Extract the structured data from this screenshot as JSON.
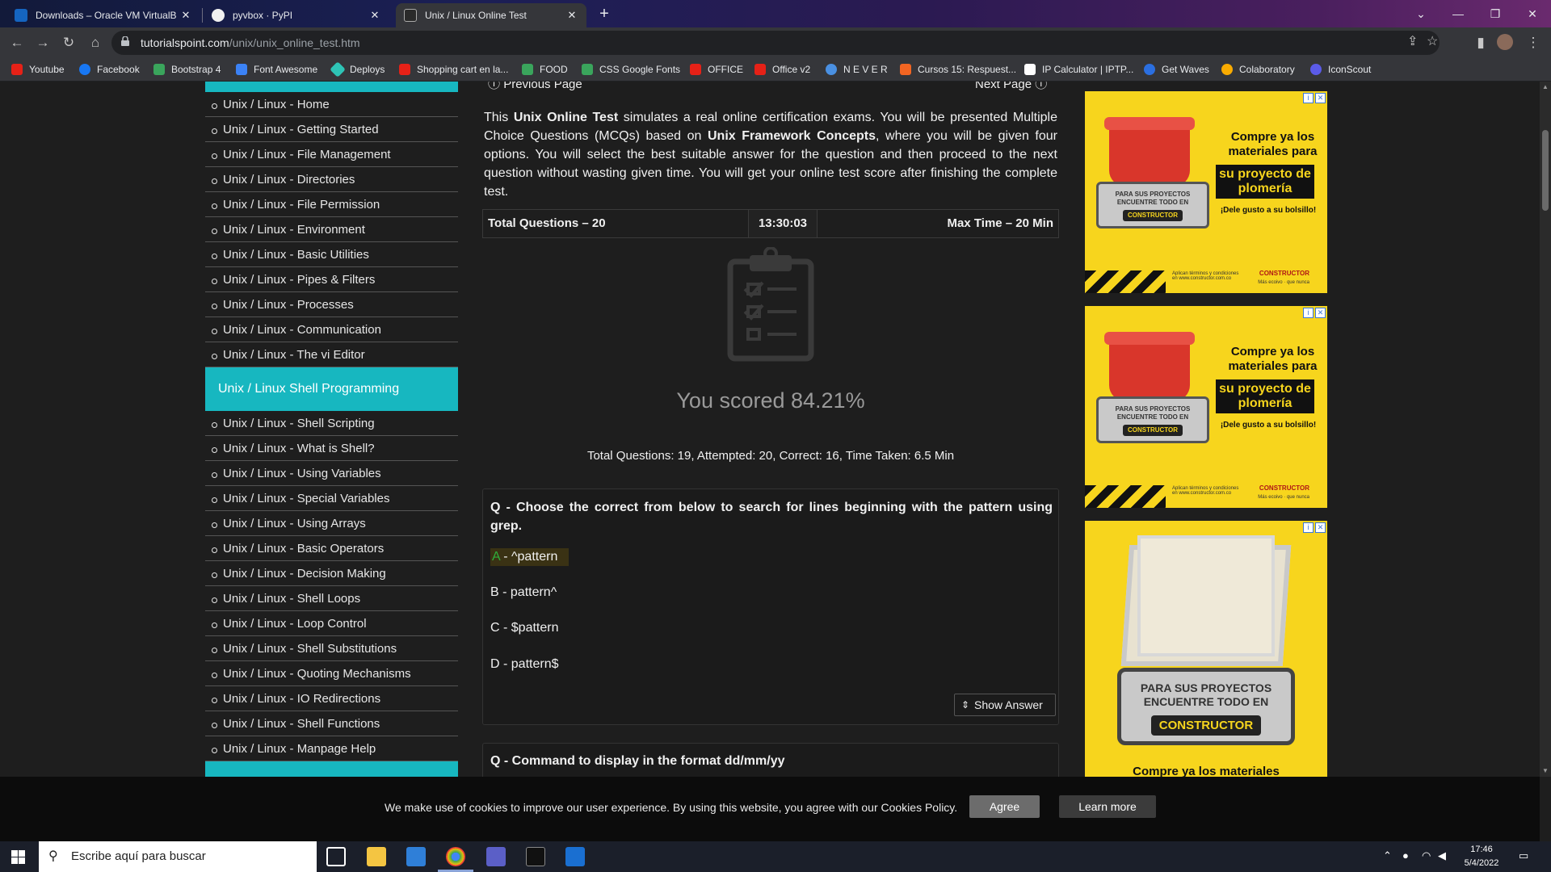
{
  "browser": {
    "tabs": [
      {
        "title": "Downloads – Oracle VM VirtualB",
        "active": false,
        "favicon_color": "#1565c0"
      },
      {
        "title": "pyvbox · PyPI",
        "active": false,
        "favicon_color": "#f0f0f0"
      },
      {
        "title": "Unix / Linux Online Test",
        "active": true,
        "favicon_color": "#2a2a2a"
      }
    ],
    "url_domain": "tutorialspoint.com",
    "url_path": "/unix/unix_online_test.htm",
    "bookmarks": [
      {
        "label": "Youtube",
        "color": "#e62117"
      },
      {
        "label": "Facebook",
        "color": "#1877f2"
      },
      {
        "label": "Bootstrap 4",
        "color": "#3aa55c"
      },
      {
        "label": "Font Awesome",
        "color": "#3b82f6"
      },
      {
        "label": "Deploys",
        "color": "#2ec4b6"
      },
      {
        "label": "Shopping cart en la...",
        "color": "#e62117"
      },
      {
        "label": "FOOD",
        "color": "#3aa55c"
      },
      {
        "label": "CSS Google Fonts",
        "color": "#3aa55c"
      },
      {
        "label": "OFFICE",
        "color": "#e62117"
      },
      {
        "label": "Office v2",
        "color": "#e62117"
      },
      {
        "label": "N E V E R",
        "color": "#4a90e2"
      },
      {
        "label": "Cursos 15: Respuest...",
        "color": "#f26522"
      },
      {
        "label": "IP Calculator | IPTP...",
        "color": "#ffffff"
      },
      {
        "label": "Get Waves",
        "color": "#2b6fe0"
      },
      {
        "label": "Colaboratory",
        "color": "#f9ab00"
      },
      {
        "label": "IconScout",
        "color": "#5b5be8"
      }
    ]
  },
  "sidebar": {
    "items_group1": [
      "Unix / Linux - Home",
      "Unix / Linux - Getting Started",
      "Unix / Linux - File Management",
      "Unix / Linux - Directories",
      "Unix / Linux - File Permission",
      "Unix / Linux - Environment",
      "Unix / Linux - Basic Utilities",
      "Unix / Linux - Pipes & Filters",
      "Unix / Linux - Processes",
      "Unix / Linux - Communication",
      "Unix / Linux - The vi Editor"
    ],
    "section2_title": "Unix / Linux Shell Programming",
    "items_group2": [
      "Unix / Linux - Shell Scripting",
      "Unix / Linux - What is Shell?",
      "Unix / Linux - Using Variables",
      "Unix / Linux - Special Variables",
      "Unix / Linux - Using Arrays",
      "Unix / Linux - Basic Operators",
      "Unix / Linux - Decision Making",
      "Unix / Linux - Shell Loops",
      "Unix / Linux - Loop Control",
      "Unix / Linux - Shell Substitutions",
      "Unix / Linux - Quoting Mechanisms",
      "Unix / Linux - IO Redirections",
      "Unix / Linux - Shell Functions",
      "Unix / Linux - Manpage Help"
    ],
    "accent_color": "#17b7c0"
  },
  "content": {
    "prev_label": "Previous Page",
    "next_label": "Next Page",
    "intro_pre": "This ",
    "intro_b1": "Unix Online Test",
    "intro_mid1": " simulates a real online certification exams. You will be presented Multiple Choice Questions (MCQs) based on ",
    "intro_b2": "Unix Framework Concepts",
    "intro_post": ", where you will be given four options. You will select the best suitable answer for the question and then proceed to the next question without wasting given time. You will get your online test score after finishing the complete test.",
    "total_questions_label": "Total Questions – 20",
    "timer": "13:30:03",
    "max_time_label": "Max Time – 20 Min",
    "score_text": "You scored 84.21%",
    "summary_text": "Total Questions: 19, Attempted: 20, Correct: 16, Time Taken: 6.5 Min",
    "question1": {
      "title": "Q - Choose the correct from below to search for lines beginning with the pattern using grep.",
      "options": [
        {
          "letter": "A",
          "text": " - ^pattern",
          "correct": true
        },
        {
          "letter": "B",
          "text": " - pattern^",
          "correct": false
        },
        {
          "letter": "C",
          "text": " - $pattern",
          "correct": false
        },
        {
          "letter": "D",
          "text": " - pattern$",
          "correct": false
        }
      ],
      "show_answer_label": "Show Answer"
    },
    "question2": {
      "title": "Q - Command to display in the format dd/mm/yy"
    }
  },
  "ads": {
    "headline1": "Compre ya los materiales para",
    "headline2": "su proyecto de plomería",
    "headline3": "¡Dele gusto a su bolsillo!",
    "badge_text": "PARA SUS PROYECTOS ENCUENTRE TODO EN",
    "badge_brand": "CONSTRUCTOR",
    "brand_logo": "CONSTRUCTOR",
    "fine_print": "Aplican términos y condiciones en www.constructor.com.co",
    "slogan": "Más ecoivo · que nunca",
    "ad3_badge": "PARA SUS PROYECTOS ENCUENTRE TODO EN",
    "ad3_brand": "CONSTRUCTOR",
    "ad3_bottom": "Compre ya los materiales",
    "ad_bg": "#f7d51d"
  },
  "cookie": {
    "message": "We make use of cookies to improve our user experience. By using this website, you agree with our Cookies Policy.",
    "agree_label": "Agree",
    "learn_label": "Learn more"
  },
  "taskbar": {
    "search_placeholder": "Escribe aquí para buscar",
    "time": "17:46",
    "date": "5/4/2022"
  }
}
